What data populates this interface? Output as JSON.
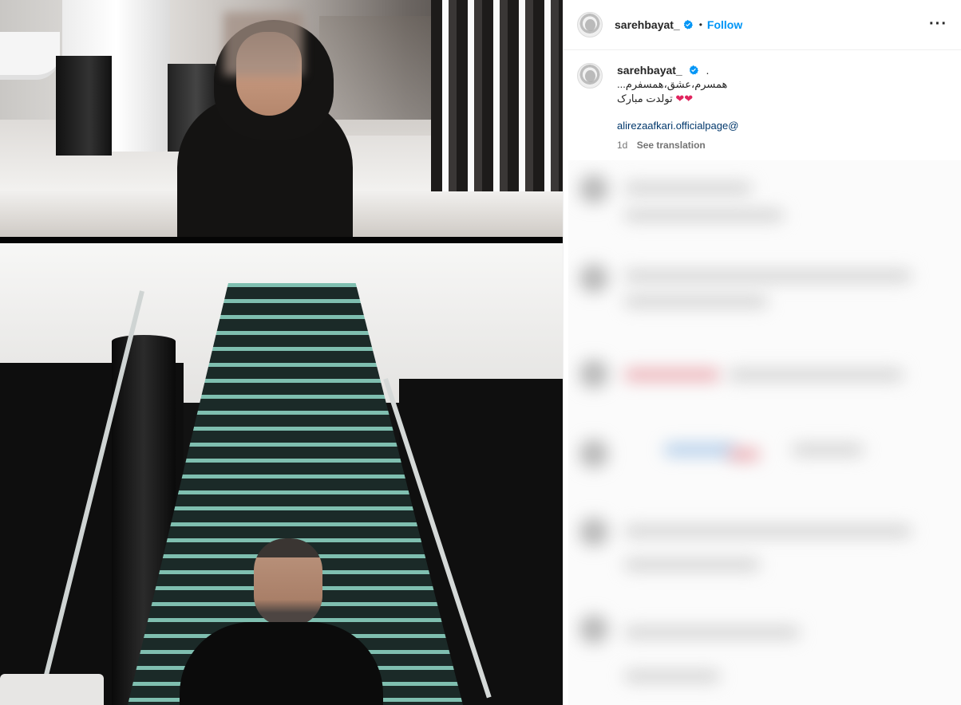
{
  "post": {
    "username": "sarehbayat_",
    "follow_label": "Follow",
    "separator": "•",
    "more_label": "···"
  },
  "caption": {
    "username": "sarehbayat_",
    "trailing": ".",
    "line1": "همسرم،عشق،همسفرم...",
    "line2": "تولدت مبارک",
    "hearts": "❤❤",
    "mention": "alirezaafkari.officialpage@",
    "time": "1d",
    "see_translation": "See translation"
  },
  "colors": {
    "accent": "#0095f6",
    "verified": "#0095f6",
    "text": "#262626",
    "muted": "#737373",
    "link": "#00376b"
  },
  "icons": {
    "verified": "verified-badge-icon",
    "more": "more-options-icon"
  }
}
